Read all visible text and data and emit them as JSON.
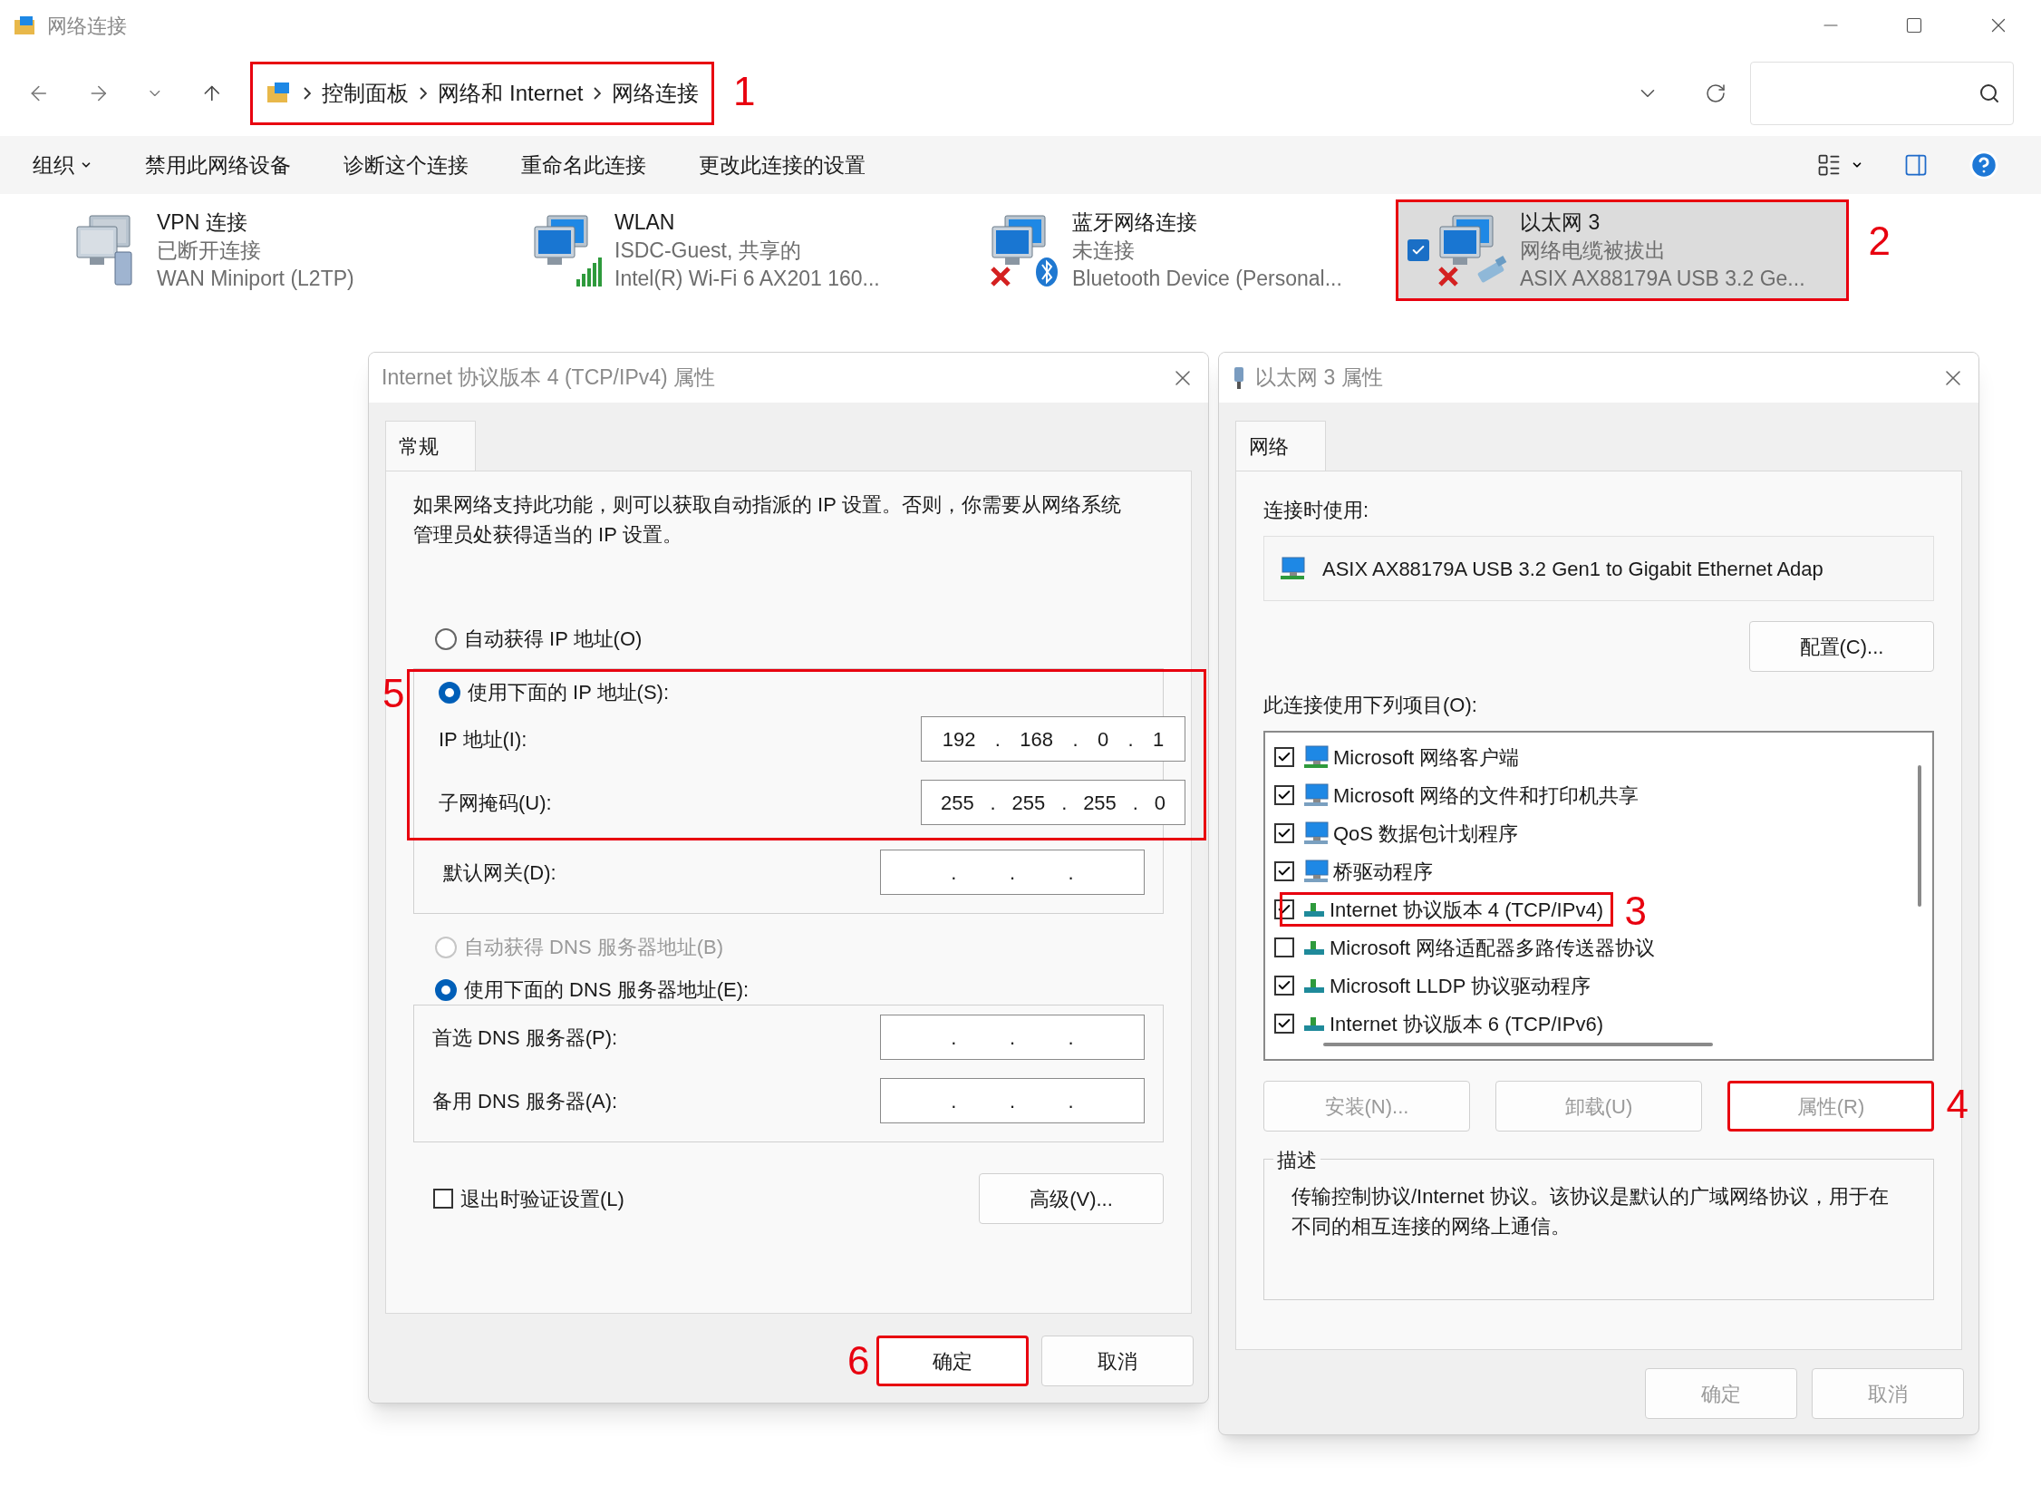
{
  "window": {
    "title": "网络连接"
  },
  "address_bar": {
    "breadcrumb": [
      "控制面板",
      "网络和 Internet",
      "网络连接"
    ],
    "annotation": "1"
  },
  "toolbar": [
    {
      "label": "组织",
      "kind": "dropdown"
    },
    {
      "label": "禁用此网络设备",
      "kind": "command"
    },
    {
      "label": "诊断这个连接",
      "kind": "command"
    },
    {
      "label": "重命名此连接",
      "kind": "command"
    },
    {
      "label": "更改此连接的设置",
      "kind": "command"
    }
  ],
  "connections": [
    {
      "name": "VPN 连接",
      "status": "已断开连接",
      "device": "WAN Miniport (L2TP)",
      "kind": "vpn",
      "disconnected": false,
      "selected": false
    },
    {
      "name": "WLAN",
      "status": "ISDC-Guest, 共享的",
      "device": "Intel(R) Wi-Fi 6 AX201 160...",
      "kind": "wifi",
      "disconnected": false,
      "selected": false
    },
    {
      "name": "蓝牙网络连接",
      "status": "未连接",
      "device": "Bluetooth Device (Personal...",
      "kind": "bluetooth",
      "disconnected": true,
      "selected": false
    },
    {
      "name": "以太网 3",
      "status": "网络电缆被拔出",
      "device": "ASIX AX88179A USB 3.2 Ge...",
      "kind": "ethernet",
      "disconnected": true,
      "selected": true,
      "annotation": "2"
    }
  ],
  "ipv4_dialog": {
    "title": "Internet 协议版本 4 (TCP/IPv4) 属性",
    "tabs": [
      {
        "label": "常规",
        "selected": true
      }
    ],
    "description": "如果网络支持此功能，则可以获取自动指派的 IP 设置。否则，你需要从网络系统管理员处获得适当的 IP 设置。",
    "ip_options": [
      {
        "label": "自动获得 IP 地址(O)",
        "selected": false,
        "disabled": false
      },
      {
        "label": "使用下面的 IP 地址(S):",
        "selected": true,
        "disabled": false,
        "annotation": "5"
      }
    ],
    "ip_fields": [
      {
        "label": "IP 地址(I):",
        "value": [
          "192",
          ".",
          "168",
          ".",
          "0",
          ".",
          "1"
        ]
      },
      {
        "label": "子网掩码(U):",
        "value": [
          "255",
          ".",
          "255",
          ".",
          "255",
          ".",
          "0"
        ]
      },
      {
        "label": "默认网关(D):",
        "value": [
          ".",
          ".",
          "."
        ]
      }
    ],
    "dns_options": [
      {
        "label": "自动获得 DNS 服务器地址(B)",
        "selected": false,
        "disabled": true
      },
      {
        "label": "使用下面的 DNS 服务器地址(E):",
        "selected": true,
        "disabled": false
      }
    ],
    "dns_fields": [
      {
        "label": "首选 DNS 服务器(P):",
        "value": [
          ".",
          ".",
          "."
        ]
      },
      {
        "label": "备用 DNS 服务器(A):",
        "value": [
          ".",
          ".",
          "."
        ]
      }
    ],
    "validate_on_exit": {
      "label": "退出时验证设置(L)",
      "checked": false
    },
    "advanced_button": "高级(V)...",
    "buttons": [
      {
        "label": "确定",
        "annotation": "6"
      },
      {
        "label": "取消"
      }
    ]
  },
  "adapter_dialog": {
    "title": "以太网 3 属性",
    "tabs": [
      {
        "label": "网络",
        "selected": true
      }
    ],
    "connect_using_label": "连接时使用:",
    "adapter_name": "ASIX AX88179A USB 3.2 Gen1 to Gigabit Ethernet Adap",
    "configure_button": "配置(C)...",
    "items_label": "此连接使用下列项目(O):",
    "items": [
      {
        "label": "Microsoft 网络客户端",
        "checked": true,
        "kind": "client"
      },
      {
        "label": "Microsoft 网络的文件和打印机共享",
        "checked": true,
        "kind": "service"
      },
      {
        "label": "QoS 数据包计划程序",
        "checked": true,
        "kind": "service"
      },
      {
        "label": "桥驱动程序",
        "checked": true,
        "kind": "service"
      },
      {
        "label": "Internet 协议版本 4 (TCP/IPv4)",
        "checked": true,
        "kind": "protocol",
        "annotation": "3"
      },
      {
        "label": "Microsoft 网络适配器多路传送器协议",
        "checked": false,
        "kind": "protocol"
      },
      {
        "label": "Microsoft LLDP 协议驱动程序",
        "checked": true,
        "kind": "protocol"
      },
      {
        "label": "Internet 协议版本 6 (TCP/IPv6)",
        "checked": true,
        "kind": "protocol"
      }
    ],
    "item_buttons": [
      {
        "label": "安装(N)...",
        "disabled": true
      },
      {
        "label": "卸载(U)",
        "disabled": true
      },
      {
        "label": "属性(R)",
        "disabled": true,
        "annotation": "4"
      }
    ],
    "description": {
      "title": "描述",
      "text": "传输控制协议/Internet 协议。该协议是默认的广域网络协议，用于在不同的相互连接的网络上通信。"
    },
    "buttons": [
      {
        "label": "确定",
        "disabled": true
      },
      {
        "label": "取消",
        "disabled": true
      }
    ]
  }
}
